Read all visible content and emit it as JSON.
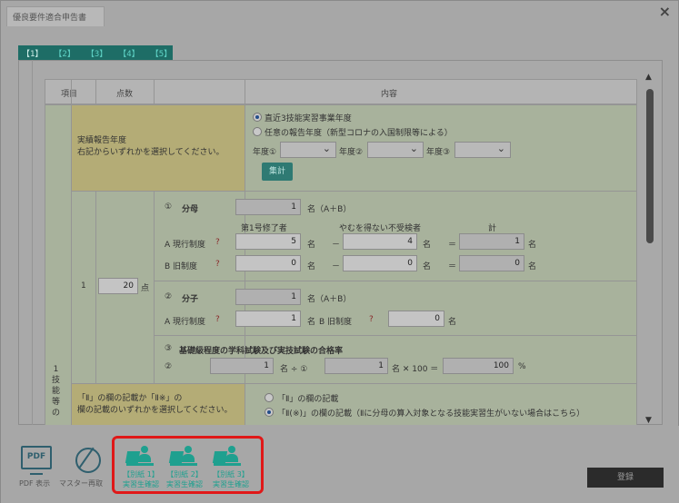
{
  "window": {
    "title": "優良要件適合申告書",
    "close_label": "×"
  },
  "tabs": [
    "【1】",
    "【2】",
    "【3】",
    "【4】",
    "【5】"
  ],
  "table": {
    "headers": [
      "項目",
      "点数",
      "内容"
    ],
    "section_label": "1\n技\n能\n等\nの",
    "row_no": "1",
    "score_value": "20",
    "score_unit": "点",
    "yellow1": "実績報告年度\n右記からいずれかを選択してください。",
    "radio_recent": "直近3技能実習事業年度",
    "radio_optional": "任意の報告年度（新型コロナの入国制限等による）",
    "year1_label": "年度①",
    "year2_label": "年度②",
    "year3_label": "年度③",
    "calc_button": "集計",
    "denominator": {
      "num": "①",
      "title": "分母",
      "total": "1",
      "unit": "名（A＋B）",
      "col1": "第1号修了者",
      "col2": "やむを得ない不受検者",
      "col3": "計",
      "rowA_label": "A  現行制度",
      "rowA_q": "?",
      "rowA_v1": "5",
      "rowA_v2": "4",
      "rowA_v3": "1",
      "rowB_label": "B  旧制度",
      "rowB_q": "?",
      "rowB_v1": "0",
      "rowB_v2": "0",
      "rowB_v3": "0",
      "mei": "名",
      "minus": "－",
      "equals": "＝"
    },
    "numerator": {
      "num": "②",
      "title": "分子",
      "total": "1",
      "unit": "名（A＋B）",
      "rowA_label": "A  現行制度",
      "rowA_q": "?",
      "rowA_v": "1",
      "rowB_label": "B  旧制度",
      "rowB_q": "?",
      "rowB_v": "0",
      "mei": "名"
    },
    "rate": {
      "num": "③",
      "title": "基礎級程度の学科試験及び実技試験の合格率",
      "lhs": "②",
      "v1": "1",
      "div": "名 ÷ ①",
      "v2": "1",
      "times": "名 ✕ 100 ＝",
      "result": "100",
      "pct": "%"
    },
    "yellow2": "「Ⅱ」の欄の記載か「Ⅱ※」の\n欄の記載のいずれかを選択してください。",
    "radio_ii": "「Ⅱ」の欄の記載",
    "radio_ii_star": "「Ⅱ(※)」の欄の記載（Ⅱに分母の算入対象となる技能実習生がいない場合はこちら）"
  },
  "footer": {
    "pdf_icon_text": "PDF",
    "pdf_label": "PDF 表示",
    "master_label": "マスター再取",
    "docs": [
      {
        "line1": "【別紙 1】",
        "line2": "実習生確認"
      },
      {
        "line1": "【別紙 2】",
        "line2": "実習生確認"
      },
      {
        "line1": "【別紙 3】",
        "line2": "実習生確認"
      }
    ],
    "register_label": "登録"
  }
}
